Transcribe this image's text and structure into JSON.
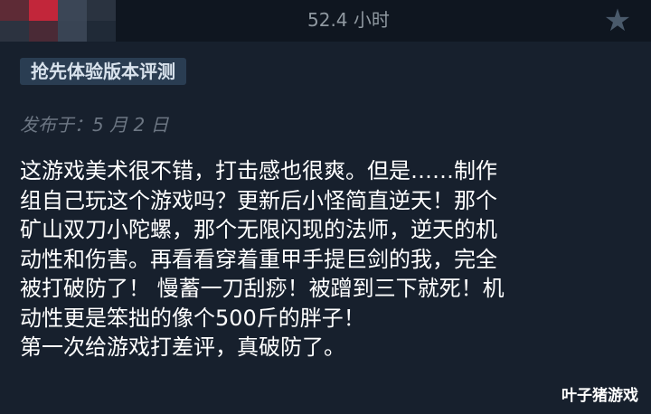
{
  "review": {
    "playtime": "52.4 小时",
    "badge": "抢先体验版本评测",
    "posted": "发布于：5 月 2 日",
    "lines": [
      "这游戏美术很不错，打击感也很爽。但是……制作",
      "组自己玩这个游戏吗？更新后小怪简直逆天！那个",
      "矿山双刀小陀螺，那个无限闪现的法师，逆天的机",
      "动性和伤害。再看看穿着重甲手提巨剑的我，完全",
      "被打破防了！ 慢蓄一刀刮痧！被蹭到三下就死！机",
      "动性更是笨拙的像个500斤的胖子！",
      "第一次给游戏打差评，真破防了。"
    ]
  },
  "watermark": "叶子猪游戏",
  "icons": {
    "star": "star-icon",
    "avatar": "pixelated-avatar"
  },
  "colors": {
    "background": "#17202d",
    "header": "#0f1620",
    "badge_bg": "#2a3d52",
    "avatar_accent": "#c2263a"
  }
}
